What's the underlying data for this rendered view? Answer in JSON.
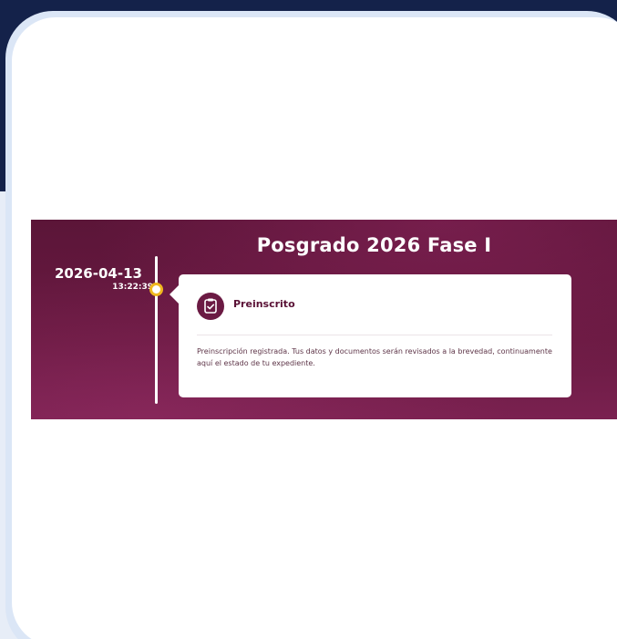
{
  "banner": {
    "title": "Posgrado 2026 Fase I"
  },
  "timeline": {
    "entries": [
      {
        "date": "2026-04-13",
        "time": "13:22:39",
        "status": "Preinscrito",
        "description": "Preinscripción registrada. Tus datos y documentos serán revisados a la brevedad, continuamente aquí el estado de tu expediente.",
        "icon": "clipboard-check-icon"
      }
    ]
  },
  "colors": {
    "page_top": "#14224a",
    "page_background": "#e7edf7",
    "banner_background": "#6a1a42",
    "timeline_dot": "#f0b81f",
    "status_text": "#5a1236"
  }
}
